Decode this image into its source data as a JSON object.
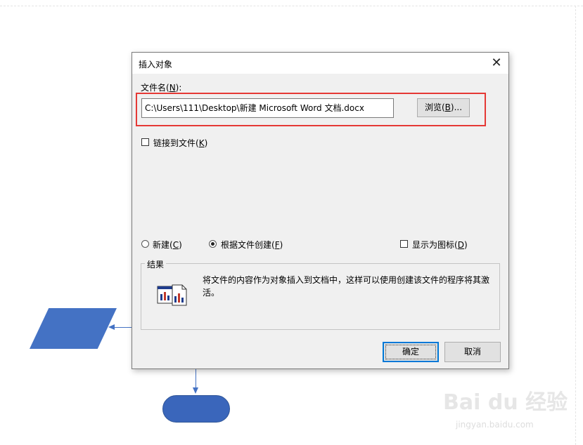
{
  "dialog": {
    "title": "插入对象",
    "close_glyph": "✕",
    "filename_label_prefix": "文件名(",
    "filename_label_key": "N",
    "filename_label_suffix": "):",
    "filename_value": "C:\\Users\\111\\Desktop\\新建 Microsoft Word 文档.docx",
    "browse_prefix": "浏览(",
    "browse_key": "B",
    "browse_suffix": ")...",
    "link_prefix": "链接到文件(",
    "link_key": "K",
    "link_suffix": ")",
    "link_checked": false,
    "new_prefix": "新建(",
    "new_key": "C",
    "new_suffix": ")",
    "from_file_prefix": "根据文件创建(",
    "from_file_key": "F",
    "from_file_suffix": ")",
    "selected_mode": "from_file",
    "show_icon_prefix": "显示为图标(",
    "show_icon_key": "D",
    "show_icon_suffix": ")",
    "show_icon_checked": false,
    "result_title": "结果",
    "result_text": "将文件的内容作为对象插入到文档中，这样可以使用创建该文件的程序将其激活。",
    "ok_label": "确定",
    "cancel_label": "取消"
  },
  "watermark": {
    "brand": "Bai du 经验",
    "url": "jingyan.baidu.com"
  },
  "colors": {
    "shape_fill": "#4472c4",
    "highlight": "#e53935",
    "dialog_bg": "#f0f0f0"
  }
}
